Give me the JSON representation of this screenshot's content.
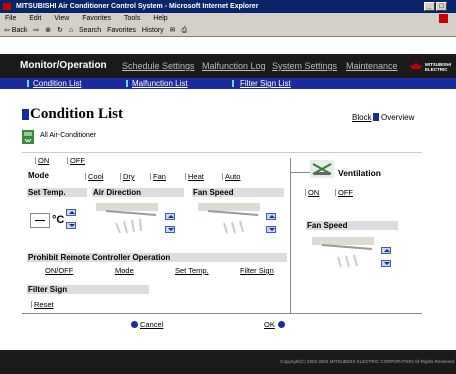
{
  "window": {
    "title": "MITSUBISHI Air Conditioner Control System - Microsoft Internet Explorer"
  },
  "menu": [
    "File",
    "Edit",
    "View",
    "Favorites",
    "Tools",
    "Help"
  ],
  "toolbar": {
    "back": "⇦ Back",
    "search": "Search",
    "favorites": "Favorites",
    "history": "History"
  },
  "nav": {
    "monitor": "Monitor/Operation",
    "schedule": "Schedule Settings",
    "malfunction": "Malfunction Log",
    "system": "System Settings",
    "maintenance": "Maintenance",
    "brand_line1": "MITSUBISHI",
    "brand_line2": "ELECTRIC"
  },
  "subnav": {
    "condition": "Condition List",
    "malfunction": "Malfunction List",
    "filter": "Filter Sign List"
  },
  "page": {
    "title": "Condition List",
    "block": "Block",
    "overview": "Overview",
    "unit": "All Air-Conditioner"
  },
  "power": {
    "on": "ON",
    "off": "OFF"
  },
  "mode": {
    "label": "Mode",
    "cool": "Cool",
    "dry": "Dry",
    "fan": "Fan",
    "heat": "Heat",
    "auto": "Auto"
  },
  "temp": {
    "label": "Set Temp.",
    "unit": "°C"
  },
  "air_direction": {
    "label": "Air Direction"
  },
  "fan_speed": {
    "label": "Fan Speed"
  },
  "ventilation": {
    "label": "Ventilation",
    "on": "ON",
    "off": "OFF",
    "fan_speed": "Fan Speed"
  },
  "prohibit": {
    "label": "Prohibit Remote Controller Operation",
    "onoff": "ON/OFF",
    "mode": "Mode",
    "temp": "Set Temp.",
    "filter": "Filter Sign"
  },
  "filter": {
    "label": "Filter Sign",
    "reset": "Reset"
  },
  "actions": {
    "cancel": "Cancel",
    "ok": "OK"
  },
  "footer": {
    "copyright": "Copyright(C) 2002-2004 MITSUBISHI ELECTRIC CORPORATION All Rights Reserved"
  },
  "colors": {
    "accent": "#1a2aa0",
    "nav_bg": "#1a1a1a",
    "brand_red": "#cc0000"
  }
}
